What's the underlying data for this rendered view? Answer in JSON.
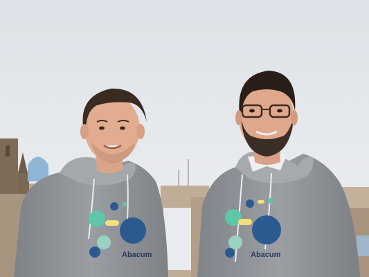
{
  "photo": {
    "subject": "two-men-rooftop-city",
    "hoodie_brand_left": "Abacum",
    "hoodie_brand_right": "Abacum"
  },
  "colors": {
    "sky_top": "#dfe4ea",
    "sky_bottom": "#eef0f2",
    "hoodie": "#8d9196",
    "logo_navy": "#2c5a8f",
    "logo_teal": "#5fc6a9",
    "logo_yellow": "#f2e07a",
    "logo_light_blue": "#9ad2c2"
  }
}
